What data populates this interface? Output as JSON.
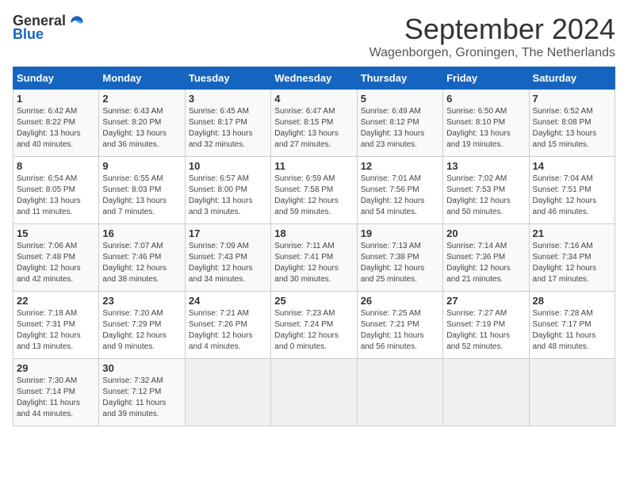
{
  "logo": {
    "general": "General",
    "blue": "Blue"
  },
  "title": "September 2024",
  "subtitle": "Wagenborgen, Groningen, The Netherlands",
  "days_of_week": [
    "Sunday",
    "Monday",
    "Tuesday",
    "Wednesday",
    "Thursday",
    "Friday",
    "Saturday"
  ],
  "weeks": [
    [
      {
        "day": "1",
        "info": "Sunrise: 6:42 AM\nSunset: 8:22 PM\nDaylight: 13 hours\nand 40 minutes."
      },
      {
        "day": "2",
        "info": "Sunrise: 6:43 AM\nSunset: 8:20 PM\nDaylight: 13 hours\nand 36 minutes."
      },
      {
        "day": "3",
        "info": "Sunrise: 6:45 AM\nSunset: 8:17 PM\nDaylight: 13 hours\nand 32 minutes."
      },
      {
        "day": "4",
        "info": "Sunrise: 6:47 AM\nSunset: 8:15 PM\nDaylight: 13 hours\nand 27 minutes."
      },
      {
        "day": "5",
        "info": "Sunrise: 6:49 AM\nSunset: 8:12 PM\nDaylight: 13 hours\nand 23 minutes."
      },
      {
        "day": "6",
        "info": "Sunrise: 6:50 AM\nSunset: 8:10 PM\nDaylight: 13 hours\nand 19 minutes."
      },
      {
        "day": "7",
        "info": "Sunrise: 6:52 AM\nSunset: 8:08 PM\nDaylight: 13 hours\nand 15 minutes."
      }
    ],
    [
      {
        "day": "8",
        "info": "Sunrise: 6:54 AM\nSunset: 8:05 PM\nDaylight: 13 hours\nand 11 minutes."
      },
      {
        "day": "9",
        "info": "Sunrise: 6:55 AM\nSunset: 8:03 PM\nDaylight: 13 hours\nand 7 minutes."
      },
      {
        "day": "10",
        "info": "Sunrise: 6:57 AM\nSunset: 8:00 PM\nDaylight: 13 hours\nand 3 minutes."
      },
      {
        "day": "11",
        "info": "Sunrise: 6:59 AM\nSunset: 7:58 PM\nDaylight: 12 hours\nand 59 minutes."
      },
      {
        "day": "12",
        "info": "Sunrise: 7:01 AM\nSunset: 7:56 PM\nDaylight: 12 hours\nand 54 minutes."
      },
      {
        "day": "13",
        "info": "Sunrise: 7:02 AM\nSunset: 7:53 PM\nDaylight: 12 hours\nand 50 minutes."
      },
      {
        "day": "14",
        "info": "Sunrise: 7:04 AM\nSunset: 7:51 PM\nDaylight: 12 hours\nand 46 minutes."
      }
    ],
    [
      {
        "day": "15",
        "info": "Sunrise: 7:06 AM\nSunset: 7:48 PM\nDaylight: 12 hours\nand 42 minutes."
      },
      {
        "day": "16",
        "info": "Sunrise: 7:07 AM\nSunset: 7:46 PM\nDaylight: 12 hours\nand 38 minutes."
      },
      {
        "day": "17",
        "info": "Sunrise: 7:09 AM\nSunset: 7:43 PM\nDaylight: 12 hours\nand 34 minutes."
      },
      {
        "day": "18",
        "info": "Sunrise: 7:11 AM\nSunset: 7:41 PM\nDaylight: 12 hours\nand 30 minutes."
      },
      {
        "day": "19",
        "info": "Sunrise: 7:13 AM\nSunset: 7:38 PM\nDaylight: 12 hours\nand 25 minutes."
      },
      {
        "day": "20",
        "info": "Sunrise: 7:14 AM\nSunset: 7:36 PM\nDaylight: 12 hours\nand 21 minutes."
      },
      {
        "day": "21",
        "info": "Sunrise: 7:16 AM\nSunset: 7:34 PM\nDaylight: 12 hours\nand 17 minutes."
      }
    ],
    [
      {
        "day": "22",
        "info": "Sunrise: 7:18 AM\nSunset: 7:31 PM\nDaylight: 12 hours\nand 13 minutes."
      },
      {
        "day": "23",
        "info": "Sunrise: 7:20 AM\nSunset: 7:29 PM\nDaylight: 12 hours\nand 9 minutes."
      },
      {
        "day": "24",
        "info": "Sunrise: 7:21 AM\nSunset: 7:26 PM\nDaylight: 12 hours\nand 4 minutes."
      },
      {
        "day": "25",
        "info": "Sunrise: 7:23 AM\nSunset: 7:24 PM\nDaylight: 12 hours\nand 0 minutes."
      },
      {
        "day": "26",
        "info": "Sunrise: 7:25 AM\nSunset: 7:21 PM\nDaylight: 11 hours\nand 56 minutes."
      },
      {
        "day": "27",
        "info": "Sunrise: 7:27 AM\nSunset: 7:19 PM\nDaylight: 11 hours\nand 52 minutes."
      },
      {
        "day": "28",
        "info": "Sunrise: 7:28 AM\nSunset: 7:17 PM\nDaylight: 11 hours\nand 48 minutes."
      }
    ],
    [
      {
        "day": "29",
        "info": "Sunrise: 7:30 AM\nSunset: 7:14 PM\nDaylight: 11 hours\nand 44 minutes."
      },
      {
        "day": "30",
        "info": "Sunrise: 7:32 AM\nSunset: 7:12 PM\nDaylight: 11 hours\nand 39 minutes."
      },
      {
        "day": "",
        "info": ""
      },
      {
        "day": "",
        "info": ""
      },
      {
        "day": "",
        "info": ""
      },
      {
        "day": "",
        "info": ""
      },
      {
        "day": "",
        "info": ""
      }
    ]
  ]
}
